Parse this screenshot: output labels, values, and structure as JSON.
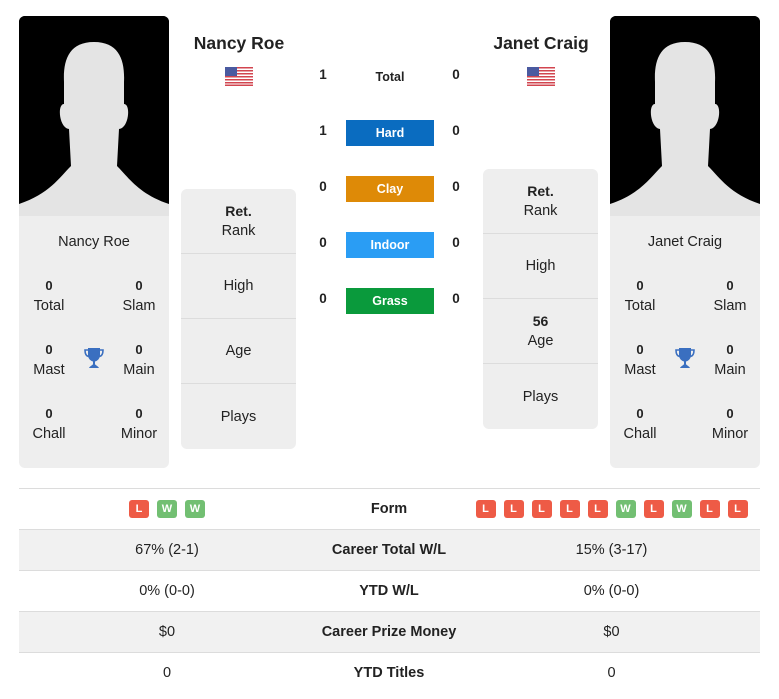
{
  "player_left": {
    "name": "Nancy Roe",
    "flag": "us-flag",
    "titles": {
      "total": {
        "value": "0",
        "label": "Total"
      },
      "slam": {
        "value": "0",
        "label": "Slam"
      },
      "mast": {
        "value": "0",
        "label": "Mast"
      },
      "main": {
        "value": "0",
        "label": "Main"
      },
      "chall": {
        "value": "0",
        "label": "Chall"
      },
      "minor": {
        "value": "0",
        "label": "Minor"
      }
    },
    "info": {
      "rank_value": "Ret.",
      "rank_label": "Rank",
      "high_value": "",
      "high_label": "High",
      "age_value": "",
      "age_label": "Age",
      "plays_value": "",
      "plays_label": "Plays"
    }
  },
  "player_right": {
    "name": "Janet Craig",
    "flag": "us-flag",
    "titles": {
      "total": {
        "value": "0",
        "label": "Total"
      },
      "slam": {
        "value": "0",
        "label": "Slam"
      },
      "mast": {
        "value": "0",
        "label": "Mast"
      },
      "main": {
        "value": "0",
        "label": "Main"
      },
      "chall": {
        "value": "0",
        "label": "Chall"
      },
      "minor": {
        "value": "0",
        "label": "Minor"
      }
    },
    "info": {
      "rank_value": "Ret.",
      "rank_label": "Rank",
      "high_value": "",
      "high_label": "High",
      "age_value": "56",
      "age_label": "Age",
      "plays_value": "",
      "plays_label": "Plays"
    }
  },
  "h2h": [
    {
      "label": "Total",
      "left": "1",
      "right": "0",
      "color": ""
    },
    {
      "label": "Hard",
      "left": "1",
      "right": "0",
      "color": "#0a6cc0"
    },
    {
      "label": "Clay",
      "left": "0",
      "right": "0",
      "color": "#de8a07"
    },
    {
      "label": "Indoor",
      "left": "0",
      "right": "0",
      "color": "#2a9df4"
    },
    {
      "label": "Grass",
      "left": "0",
      "right": "0",
      "color": "#0a9a3c"
    }
  ],
  "stats": {
    "form": {
      "label": "Form",
      "left": [
        "L",
        "W",
        "W"
      ],
      "right": [
        "L",
        "L",
        "L",
        "L",
        "L",
        "W",
        "L",
        "W",
        "L",
        "L"
      ]
    },
    "rows": [
      {
        "label": "Career Total W/L",
        "left": "67% (2-1)",
        "right": "15% (3-17)"
      },
      {
        "label": "YTD W/L",
        "left": "0% (0-0)",
        "right": "0% (0-0)"
      },
      {
        "label": "Career Prize Money",
        "left": "$0",
        "right": "$0"
      },
      {
        "label": "YTD Titles",
        "left": "0",
        "right": "0"
      }
    ]
  },
  "colors": {
    "trophy": "#3a6fc0",
    "loss": "#ee5b46",
    "win": "#72bf72"
  }
}
